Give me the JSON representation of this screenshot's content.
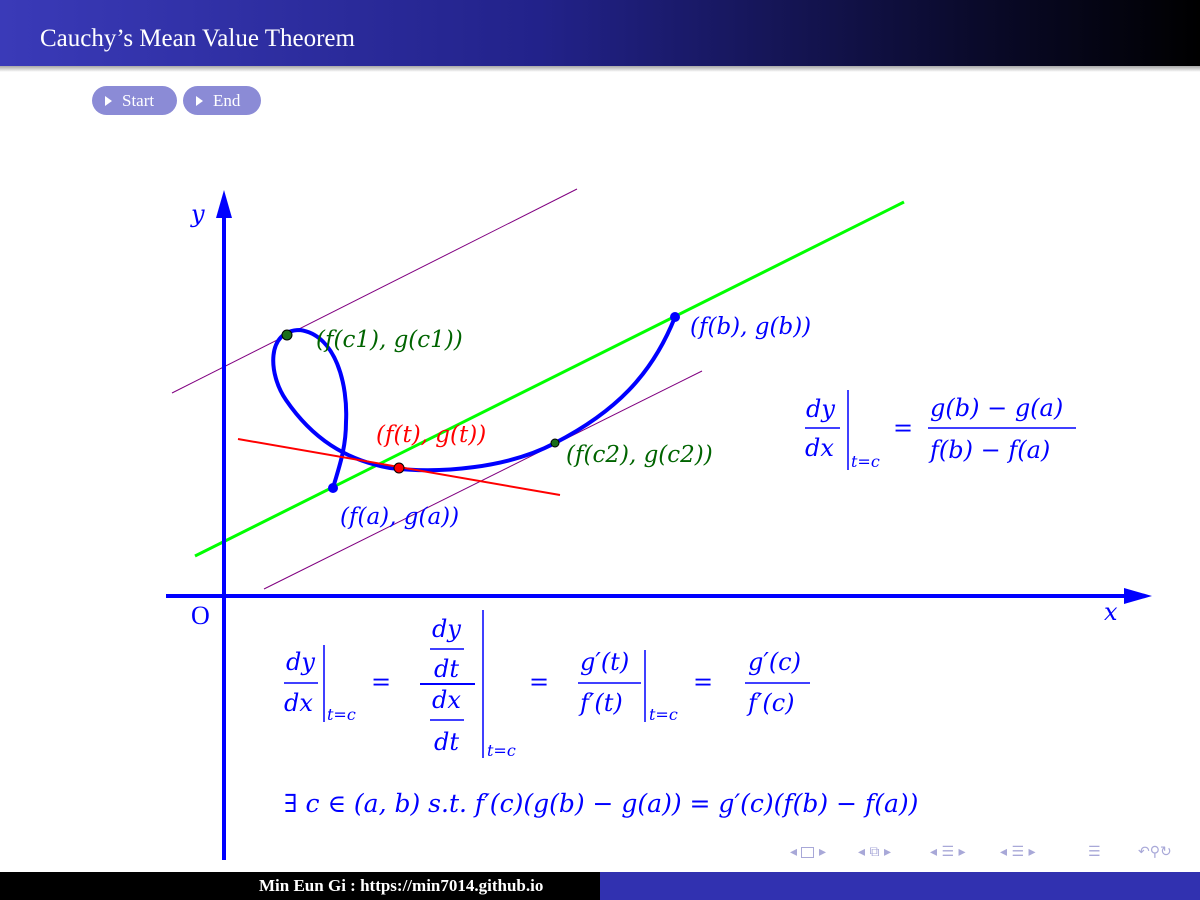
{
  "header": {
    "title": "Cauchy’s Mean Value Theorem"
  },
  "buttons": {
    "start": "Start",
    "end": "End"
  },
  "figure": {
    "axis_labels": {
      "x": "x",
      "y": "y",
      "origin": "O"
    },
    "point_labels": {
      "fa_ga": "(f(a), g(a))",
      "fb_gb": "(f(b), g(b))",
      "fc1_gc1": "(f(c1), g(c1))",
      "fc2_gc2": "(f(c2), g(c2))",
      "ft_gt": "(f(t), g(t))"
    },
    "colors": {
      "curve": "#0000ff",
      "secant": "#00ff00",
      "tangent": "#ff0000",
      "parallel": "#800080",
      "green_points": "#006400",
      "red_point": "#ff0000",
      "axes": "#0000ff"
    }
  },
  "formulas": {
    "right_side": "dy/dx |t=c = (g(b) − g(a)) / (f(b) − f(a))",
    "chain": "dy/dx |t=c = (dy/dt)/(dx/dt) |t=c = g′(t)/f′(t) |t=c = g′(c)/f′(c)",
    "conclusion": "∃ c ∈ (a, b) s.t. f′(c)(g(b) − g(a)) = g′(c)(f(b) − f(a))"
  },
  "navigation": {
    "icons": [
      "nav-left-arrow-icon",
      "slide-icon",
      "nav-right-arrow-icon",
      "nav-left-arrow-icon",
      "frame-icon",
      "nav-right-arrow-icon",
      "nav-left-arrow-icon",
      "subsection-icon",
      "nav-right-arrow-icon",
      "nav-left-arrow-icon",
      "section-icon",
      "nav-right-arrow-icon",
      "toc-icon",
      "back-icon",
      "search-icon"
    ]
  },
  "footer": {
    "author": "Min Eun Gi : https://min7014.github.io"
  }
}
